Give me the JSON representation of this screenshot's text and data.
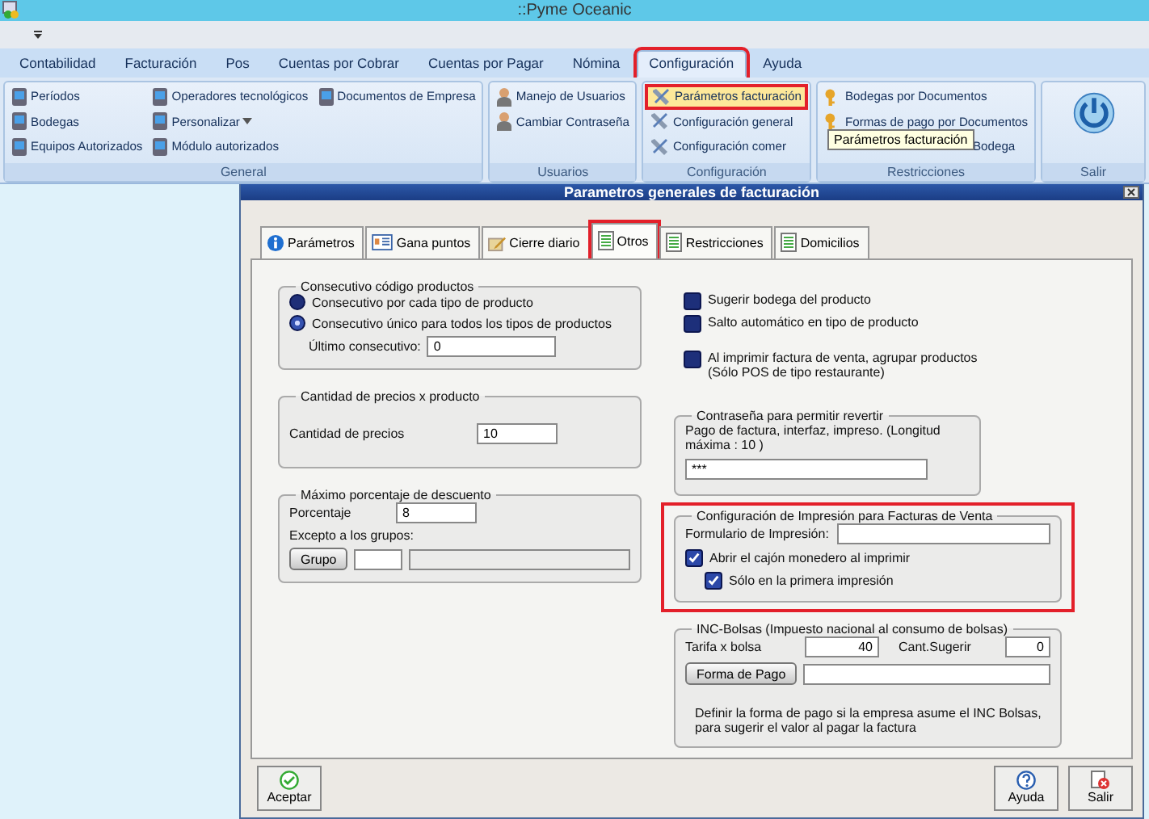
{
  "window": {
    "title": "::Pyme Oceanic"
  },
  "ribbon": {
    "tabs": [
      {
        "label": "Contabilidad",
        "selected": false,
        "highlighted": false
      },
      {
        "label": "Facturación",
        "selected": false,
        "highlighted": false
      },
      {
        "label": "Pos",
        "selected": false,
        "highlighted": false
      },
      {
        "label": "Cuentas por Cobrar",
        "selected": false,
        "highlighted": false
      },
      {
        "label": "Cuentas por Pagar",
        "selected": false,
        "highlighted": false
      },
      {
        "label": "Nómina",
        "selected": false,
        "highlighted": false
      },
      {
        "label": "Configuración",
        "selected": true,
        "highlighted": true
      },
      {
        "label": "Ayuda",
        "selected": false,
        "highlighted": false
      }
    ],
    "groups": [
      {
        "label": "General",
        "columns": [
          [
            {
              "label": "Períodos"
            },
            {
              "label": "Bodegas"
            },
            {
              "label": "Equipos Autorizados"
            }
          ],
          [
            {
              "label": "Operadores tecnológicos"
            },
            {
              "label": "Personalizar",
              "has_menu": true
            },
            {
              "label": "Módulo autorizados"
            }
          ],
          [
            {
              "label": "Documentos de Empresa"
            }
          ]
        ]
      },
      {
        "label": "Usuarios",
        "columns": [
          [
            {
              "label": "Manejo de Usuarios"
            },
            {
              "label": "Cambiar Contraseña"
            }
          ]
        ]
      },
      {
        "label": "Configuración",
        "columns": [
          [
            {
              "label": "Parámetros facturación",
              "hovered": true,
              "highlighted": true
            },
            {
              "label": "Configuración general"
            },
            {
              "label": "Configuración comer"
            }
          ]
        ]
      },
      {
        "label": "Restricciones",
        "columns": [
          [
            {
              "label": "Bodegas por Documentos"
            },
            {
              "label": "Formas de pago por Documentos"
            },
            {
              "label": "Bodega"
            }
          ]
        ]
      },
      {
        "label": "Salir"
      }
    ]
  },
  "tooltip": {
    "text": "Parámetros facturación"
  },
  "dialog": {
    "title": "Parametros generales de facturación",
    "tabs": [
      {
        "label": "Parámetros",
        "selected": false,
        "highlighted": false
      },
      {
        "label": "Gana puntos",
        "selected": false,
        "highlighted": false
      },
      {
        "label": "Cierre diario",
        "selected": false,
        "highlighted": false
      },
      {
        "label": "Otros",
        "selected": true,
        "highlighted": true
      },
      {
        "label": "Restricciones",
        "selected": false,
        "highlighted": false
      },
      {
        "label": "Domicilios",
        "selected": false,
        "highlighted": false
      }
    ],
    "consecutivo": {
      "title": "Consecutivo código productos",
      "options": [
        {
          "label": "Consecutivo por cada tipo de producto",
          "selected": false
        },
        {
          "label": "Consecutivo único para todos los tipos de productos",
          "selected": true
        }
      ],
      "last_label": "Último consecutivo:",
      "last_value": "0"
    },
    "precios": {
      "title": "Cantidad de precios x producto",
      "label": "Cantidad de precios",
      "value": "10"
    },
    "descuento": {
      "title": "Máximo porcentaje de descuento",
      "label": "Porcentaje",
      "value": "8",
      "groups_label": "Excepto a los grupos:",
      "button": "Grupo",
      "fields": [
        {
          "disabled": false
        },
        {
          "disabled": true
        }
      ]
    },
    "options": [
      {
        "label": "Sugerir bodega del producto",
        "checked": false
      },
      {
        "label": "Salto automático en tipo de producto",
        "checked": false
      },
      {
        "label": "Al imprimir factura de venta, agrupar productos (Sólo POS de tipo restaurante)",
        "checked": false
      }
    ],
    "contrasena": {
      "title": "Contraseña para permitir revertir",
      "text": "Pago de factura, interfaz, impreso.  (Longitud máxima : 10 )",
      "value": "***"
    },
    "impresion": {
      "title": "Configuración de Impresión para Facturas de Venta",
      "highlighted": true,
      "form_label": "Formulario de Impresión:",
      "checks": [
        {
          "label": "Abrir el cajón monedero al imprimir",
          "checked": true,
          "children": [
            {
              "label": "Sólo en la primera impresión",
              "checked": true
            }
          ]
        }
      ]
    },
    "inc": {
      "title": "INC-Bolsas (Impuesto nacional al consumo de bolsas)",
      "rate_label": "Tarifa x bolsa",
      "rate": "40",
      "suggest_label": "Cant.Sugerir",
      "suggest": "0",
      "button": "Forma de Pago",
      "note": "Definir la forma de pago si la empresa asume el INC Bolsas, para sugerir el valor al pagar la factura"
    },
    "footer": [
      {
        "label": "Aceptar"
      },
      {
        "label": "Ayuda"
      },
      {
        "label": "Salir"
      }
    ]
  }
}
